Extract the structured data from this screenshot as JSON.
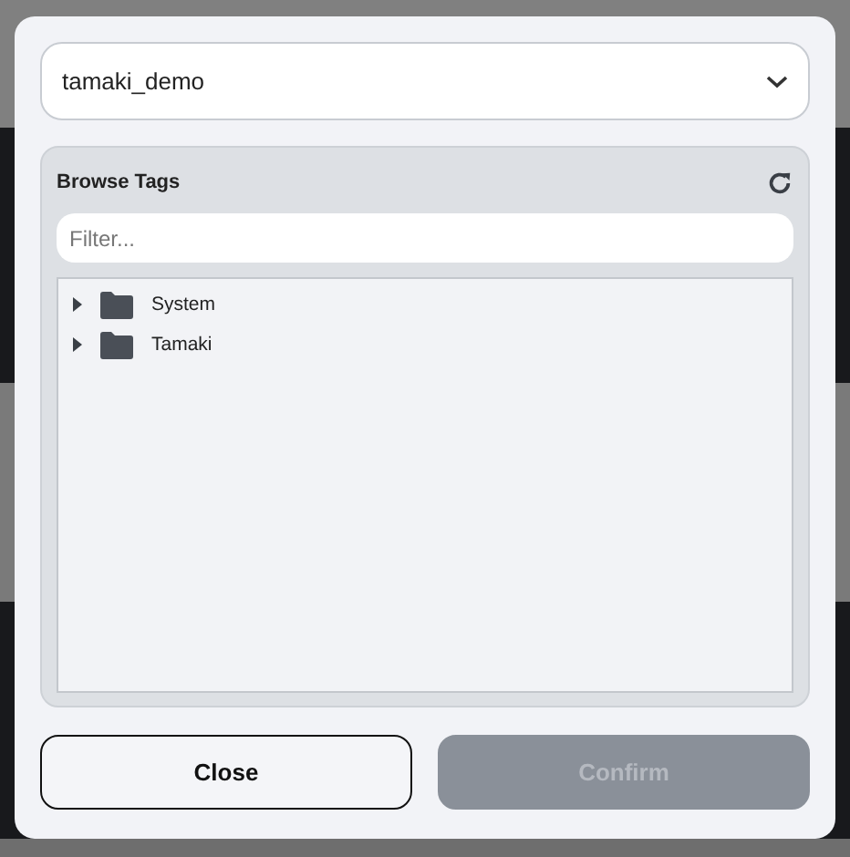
{
  "database_select": {
    "value": "tamaki_demo"
  },
  "tag_browser": {
    "title": "Browse Tags",
    "filter": {
      "placeholder": "Filter..."
    },
    "tree": [
      {
        "label": "System",
        "expanded": false
      },
      {
        "label": "Tamaki",
        "expanded": false
      }
    ]
  },
  "buttons": [
    {
      "label": "Close",
      "disabled": false
    },
    {
      "label": "Confirm",
      "disabled": true
    }
  ]
}
